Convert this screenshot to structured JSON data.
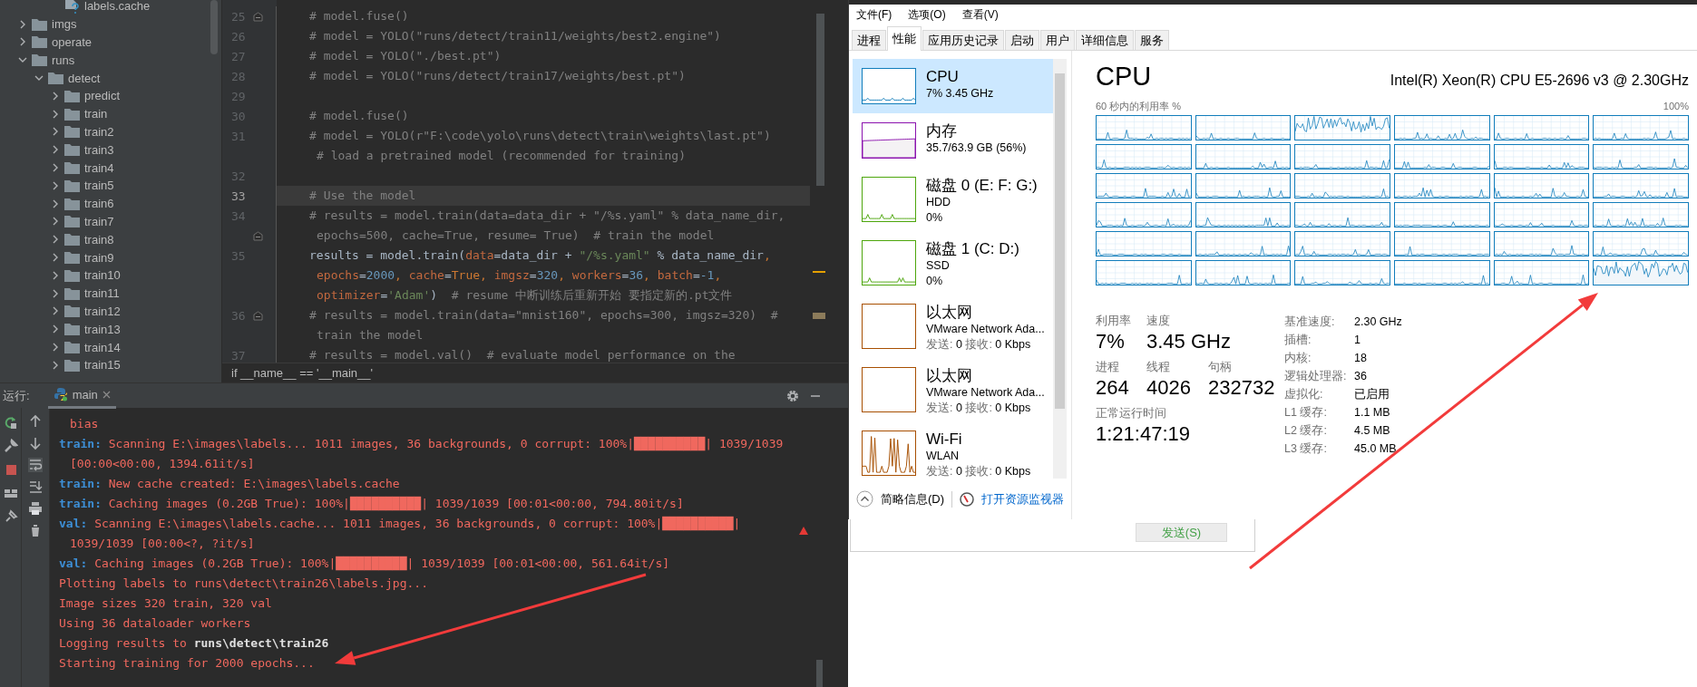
{
  "project_tree": {
    "items": [
      {
        "children": [
          {
            "children": [
              {
                "label": "labels.cache",
                "kind": "file"
              }
            ]
          }
        ]
      },
      {
        "label": "imgs",
        "kind": "folder",
        "expanded": false
      },
      {
        "label": "operate",
        "kind": "folder",
        "expanded": false
      },
      {
        "label": "runs",
        "kind": "folder",
        "expanded": true,
        "children": [
          {
            "label": "detect",
            "kind": "folder",
            "expanded": true,
            "children": [
              {
                "label": "predict",
                "kind": "folder",
                "expanded": false
              },
              {
                "label": "train",
                "kind": "folder",
                "expanded": false
              },
              {
                "label": "train2",
                "kind": "folder",
                "expanded": false
              },
              {
                "label": "train3",
                "kind": "folder",
                "expanded": false
              },
              {
                "label": "train4",
                "kind": "folder",
                "expanded": false
              },
              {
                "label": "train5",
                "kind": "folder",
                "expanded": false
              },
              {
                "label": "train6",
                "kind": "folder",
                "expanded": false
              },
              {
                "label": "train7",
                "kind": "folder",
                "expanded": false
              },
              {
                "label": "train8",
                "kind": "folder",
                "expanded": false
              },
              {
                "label": "train9",
                "kind": "folder",
                "expanded": false
              },
              {
                "label": "train10",
                "kind": "folder",
                "expanded": false
              },
              {
                "label": "train11",
                "kind": "folder",
                "expanded": false
              },
              {
                "label": "train12",
                "kind": "folder",
                "expanded": false
              },
              {
                "label": "train13",
                "kind": "folder",
                "expanded": false
              },
              {
                "label": "train14",
                "kind": "folder",
                "expanded": false
              },
              {
                "label": "train15",
                "kind": "folder",
                "expanded": false
              }
            ]
          }
        ]
      }
    ]
  },
  "editor": {
    "lines": [
      {
        "number": "25",
        "current": false,
        "rows": [
          {
            "fold_marker": true,
            "segments": [
              {
                "text": "# model.fuse()",
                "kind": "comment"
              }
            ]
          }
        ]
      },
      {
        "number": "26",
        "current": false,
        "rows": [
          {
            "fold_marker": false,
            "segments": [
              {
                "text": "# model = YOLO(\"runs/detect/train11/weights/best2.engine\")",
                "kind": "comment"
              }
            ]
          }
        ]
      },
      {
        "number": "27",
        "current": false,
        "rows": [
          {
            "fold_marker": false,
            "segments": [
              {
                "text": "# model = YOLO(\"./best.pt\")",
                "kind": "comment"
              }
            ]
          }
        ]
      },
      {
        "number": "28",
        "current": false,
        "rows": [
          {
            "fold_marker": false,
            "segments": [
              {
                "text": "# model = YOLO(\"runs/detect/train17/weights/best.pt\")",
                "kind": "comment"
              }
            ]
          }
        ]
      },
      {
        "number": "29",
        "current": false,
        "rows": [
          {
            "fold_marker": false,
            "segments": []
          }
        ]
      },
      {
        "number": "30",
        "current": false,
        "rows": [
          {
            "fold_marker": false,
            "segments": [
              {
                "text": "# model.fuse()",
                "kind": "comment"
              }
            ]
          }
        ]
      },
      {
        "number": "31",
        "current": false,
        "rows": [
          {
            "fold_marker": false,
            "segments": [
              {
                "text": "# model = YOLO(r\"F:\\code\\yolo\\runs\\detect\\train\\weights\\last.pt\")",
                "kind": "comment"
              }
            ]
          },
          {
            "fold_marker": false,
            "segments": [
              {
                "text": "# load a pretrained model (recommended for training)",
                "kind": "comment"
              }
            ]
          }
        ]
      },
      {
        "number": "32",
        "current": false,
        "rows": [
          {
            "fold_marker": false,
            "segments": []
          }
        ]
      },
      {
        "number": "33",
        "current": true,
        "rows": [
          {
            "fold_marker": false,
            "segments": [
              {
                "text": "# Use the model",
                "kind": "comment"
              }
            ]
          }
        ]
      },
      {
        "number": "34",
        "current": false,
        "rows": [
          {
            "fold_marker": false,
            "segments": [
              {
                "text": "# results = model.train(data=data_dir + \"/%s.yaml\" % data_name_dir,",
                "kind": "comment"
              }
            ]
          },
          {
            "fold_marker": true,
            "segments": [
              {
                "text": "epochs=500, cache=True, resume= True)  # train the model",
                "kind": "comment"
              }
            ]
          }
        ]
      },
      {
        "number": "35",
        "current": false,
        "rows": [
          {
            "fold_marker": false,
            "segments": [
              {
                "text": "results = model.train(",
                "kind": "plain"
              },
              {
                "text": "data",
                "kind": "param"
              },
              {
                "text": "=data_dir + ",
                "kind": "plain"
              },
              {
                "text": "\"/%s.yaml\"",
                "kind": "string"
              },
              {
                "text": " % data_name_dir",
                "kind": "plain"
              },
              {
                "text": ",",
                "kind": "keyword"
              }
            ]
          },
          {
            "fold_marker": false,
            "segments": [
              {
                "text": "epochs",
                "kind": "param"
              },
              {
                "text": "=",
                "kind": "plain"
              },
              {
                "text": "2000",
                "kind": "number"
              },
              {
                "text": ", ",
                "kind": "keyword"
              },
              {
                "text": "cache",
                "kind": "param"
              },
              {
                "text": "=",
                "kind": "plain"
              },
              {
                "text": "True",
                "kind": "keyword"
              },
              {
                "text": ", ",
                "kind": "keyword"
              },
              {
                "text": "imgsz",
                "kind": "param"
              },
              {
                "text": "=",
                "kind": "plain"
              },
              {
                "text": "320",
                "kind": "number"
              },
              {
                "text": ", ",
                "kind": "keyword"
              },
              {
                "text": "workers",
                "kind": "param"
              },
              {
                "text": "=",
                "kind": "plain"
              },
              {
                "text": "36",
                "kind": "number"
              },
              {
                "text": ", ",
                "kind": "keyword"
              },
              {
                "text": "batch",
                "kind": "param"
              },
              {
                "text": "=",
                "kind": "plain"
              },
              {
                "text": "-1",
                "kind": "number"
              },
              {
                "text": ",",
                "kind": "keyword"
              }
            ]
          },
          {
            "fold_marker": false,
            "segments": [
              {
                "text": "optimizer",
                "kind": "param"
              },
              {
                "text": "=",
                "kind": "plain"
              },
              {
                "text": "'Adam'",
                "kind": "string"
              },
              {
                "text": ")  ",
                "kind": "plain"
              },
              {
                "text": "# resume 中断训练后重新开始 要指定新的.pt文件",
                "kind": "comment"
              }
            ]
          }
        ]
      },
      {
        "number": "36",
        "current": false,
        "rows": [
          {
            "fold_marker": true,
            "segments": [
              {
                "text": "# results = model.train(data=\"mnist160\", epochs=300, imgsz=320)  #",
                "kind": "comment"
              }
            ]
          },
          {
            "fold_marker": false,
            "segments": [
              {
                "text": "train the model",
                "kind": "comment"
              }
            ]
          }
        ]
      },
      {
        "number": "37",
        "current": false,
        "rows": [
          {
            "fold_marker": false,
            "segments": [
              {
                "text": "# results = model.val()  # evaluate model performance on the",
                "kind": "comment"
              }
            ]
          }
        ]
      }
    ],
    "breadcrumb": "if __name__ == '__main__'"
  },
  "run_panel": {
    "label": "运行:",
    "tab": "main",
    "console": [
      {
        "wrapped": true,
        "segments": [
          {
            "text": "bias",
            "kind": "text"
          }
        ]
      },
      {
        "wrapped": false,
        "segments": [
          {
            "text": "train:",
            "kind": "prefix"
          },
          {
            "text": " Scanning E:\\images\\labels... 1011 images, 36 backgrounds, 0 corrupt: 100%|██████████| 1039/1039",
            "kind": "text"
          }
        ]
      },
      {
        "wrapped": true,
        "segments": [
          {
            "text": "[00:00<00:00, 1394.61it/s]",
            "kind": "text"
          }
        ]
      },
      {
        "wrapped": false,
        "segments": [
          {
            "text": "train:",
            "kind": "prefix"
          },
          {
            "text": " New cache created: E:\\images\\labels.cache",
            "kind": "text"
          }
        ]
      },
      {
        "wrapped": false,
        "segments": [
          {
            "text": "train:",
            "kind": "prefix"
          },
          {
            "text": " Caching images (0.2GB True): 100%|██████████| 1039/1039 [00:01<00:00, 794.80it/s]",
            "kind": "text"
          }
        ]
      },
      {
        "wrapped": false,
        "segments": [
          {
            "text": "val:",
            "kind": "prefix"
          },
          {
            "text": " Scanning E:\\images\\labels.cache... 1011 images, 36 backgrounds, 0 corrupt: 100%|██████████|",
            "kind": "text"
          }
        ]
      },
      {
        "wrapped": true,
        "segments": [
          {
            "text": "1039/1039 [00:00<?, ?it/s]",
            "kind": "text"
          }
        ]
      },
      {
        "wrapped": false,
        "segments": [
          {
            "text": "val:",
            "kind": "prefix"
          },
          {
            "text": " Caching images (0.2GB True): 100%|██████████| 1039/1039 [00:01<00:00, 561.64it/s]",
            "kind": "text"
          }
        ]
      },
      {
        "wrapped": false,
        "segments": [
          {
            "text": "Plotting labels to runs\\detect\\train26\\labels.jpg...",
            "kind": "text"
          }
        ]
      },
      {
        "wrapped": false,
        "segments": [
          {
            "text": "Image sizes 320 train, 320 val",
            "kind": "text"
          }
        ]
      },
      {
        "wrapped": false,
        "segments": [
          {
            "text": "Using 36 dataloader workers",
            "kind": "text"
          }
        ]
      },
      {
        "wrapped": false,
        "segments": [
          {
            "text": "Logging results to ",
            "kind": "text"
          },
          {
            "text": "runs\\detect\\train26",
            "kind": "bold"
          }
        ]
      },
      {
        "wrapped": false,
        "segments": [
          {
            "text": "Starting training for 2000 epochs...",
            "kind": "text"
          }
        ]
      }
    ]
  },
  "task_manager": {
    "menu": [
      "文件(F)",
      "选项(O)",
      "查看(V)"
    ],
    "tabs": [
      {
        "label": "进程",
        "selected": false
      },
      {
        "label": "性能",
        "selected": true
      },
      {
        "label": "应用历史记录",
        "selected": false
      },
      {
        "label": "启动",
        "selected": false
      },
      {
        "label": "用户",
        "selected": false
      },
      {
        "label": "详细信息",
        "selected": false
      },
      {
        "label": "服务",
        "selected": false
      }
    ],
    "resources": [
      {
        "kind": "cpu",
        "name": "CPU",
        "details": [
          "7% 3.45 GHz"
        ],
        "color": "#117dbb",
        "selected": true
      },
      {
        "kind": "memory",
        "name": "内存",
        "details": [
          "35.7/63.9 GB (56%)"
        ],
        "color": "#8b12ae",
        "selected": false
      },
      {
        "kind": "disk",
        "name": "磁盘 0 (E: F: G:)",
        "details": [
          "HDD",
          "0%"
        ],
        "color": "#4da60c",
        "selected": false
      },
      {
        "kind": "disk",
        "name": "磁盘 1 (C: D:)",
        "details": [
          "SSD",
          "0%"
        ],
        "color": "#4da60c",
        "selected": false
      },
      {
        "kind": "ethernet",
        "name": "以太网",
        "details": [
          "VMware Network Ada..."
        ],
        "rates": [
          {
            "label": "发送:",
            "value": "0"
          },
          {
            "label": "接收:",
            "value": "0 Kbps"
          }
        ],
        "color": "#a74f01",
        "selected": false
      },
      {
        "kind": "ethernet",
        "name": "以太网",
        "details": [
          "VMware Network Ada..."
        ],
        "rates": [
          {
            "label": "发送:",
            "value": "0"
          },
          {
            "label": "接收:",
            "value": "0 Kbps"
          }
        ],
        "color": "#a74f01",
        "selected": false
      },
      {
        "kind": "wifi",
        "name": "Wi-Fi",
        "details": [
          "WLAN"
        ],
        "rates": [
          {
            "label": "发送:",
            "value": "0"
          },
          {
            "label": "接收:",
            "value": "0 Kbps"
          }
        ],
        "color": "#a74f01",
        "selected": false
      }
    ],
    "footer": {
      "fewer_details": "简略信息(D)",
      "open_monitor": "打开资源监视器"
    },
    "cpu": {
      "title": "CPU",
      "model": "Intel(R) Xeon(R) CPU E5-2696 v3 @ 2.30GHz",
      "graph_caption": "60 秒内的利用率 %",
      "graph_max": "100%",
      "stat_rows": [
        [
          {
            "label": "利用率",
            "value": "7%"
          },
          {
            "label": "速度",
            "value": "3.45 GHz"
          }
        ],
        [
          {
            "label": "进程",
            "value": "264"
          },
          {
            "label": "线程",
            "value": "4026"
          },
          {
            "label": "句柄",
            "value": "232732"
          }
        ],
        [
          {
            "label": "正常运行时间",
            "value": "1:21:47:19"
          }
        ]
      ],
      "specs": [
        {
          "label": "基准速度:",
          "value": "2.30 GHz"
        },
        {
          "label": "插槽:",
          "value": "1"
        },
        {
          "label": "内核:",
          "value": "18"
        },
        {
          "label": "逻辑处理器:",
          "value": "36"
        },
        {
          "label": "虚拟化:",
          "value": "已启用"
        },
        {
          "label": "L1 缓存:",
          "value": "1.1 MB"
        },
        {
          "label": "L2 缓存:",
          "value": "4.5 MB"
        },
        {
          "label": "L3 缓存:",
          "value": "45.0 MB"
        }
      ]
    }
  },
  "chat_box": {
    "send_button": "发送(S)"
  }
}
